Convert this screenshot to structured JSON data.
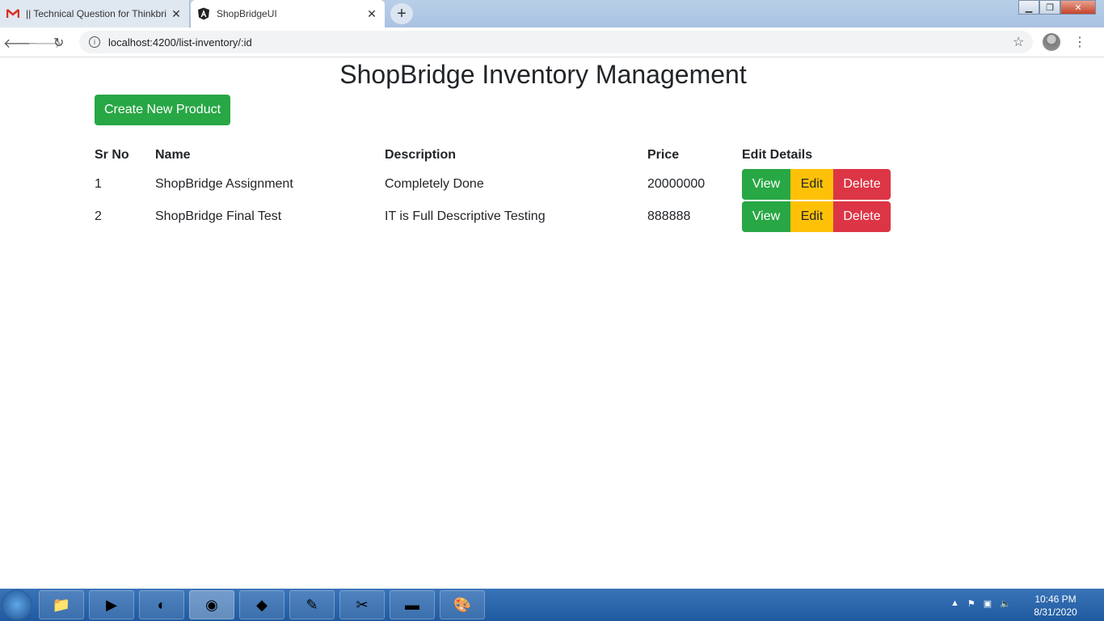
{
  "browser": {
    "tabs": [
      {
        "title": "|| Technical Question for Thinkbri",
        "favicon": "gmail-icon"
      },
      {
        "title": "ShopBridgeUI",
        "favicon": "angular-icon"
      }
    ],
    "url": "localhost:4200/list-inventory/:id"
  },
  "page": {
    "title": "ShopBridge Inventory Management",
    "create_button": "Create New Product"
  },
  "table": {
    "headers": [
      "Sr No",
      "Name",
      "Description",
      "Price",
      "Edit Details"
    ],
    "rows": [
      {
        "sr": "1",
        "name": "ShopBridge Assignment",
        "description": "Completely Done",
        "price": "20000000"
      },
      {
        "sr": "2",
        "name": "ShopBridge Final Test",
        "description": "IT is Full Descriptive Testing",
        "price": "888888"
      }
    ],
    "actions": {
      "view": "View",
      "edit": "Edit",
      "delete": "Delete"
    }
  },
  "taskbar": {
    "clock": {
      "time": "10:46 PM",
      "date": "8/31/2020"
    }
  },
  "colors": {
    "success": "#28a745",
    "warning": "#ffc107",
    "danger": "#dc3545"
  }
}
